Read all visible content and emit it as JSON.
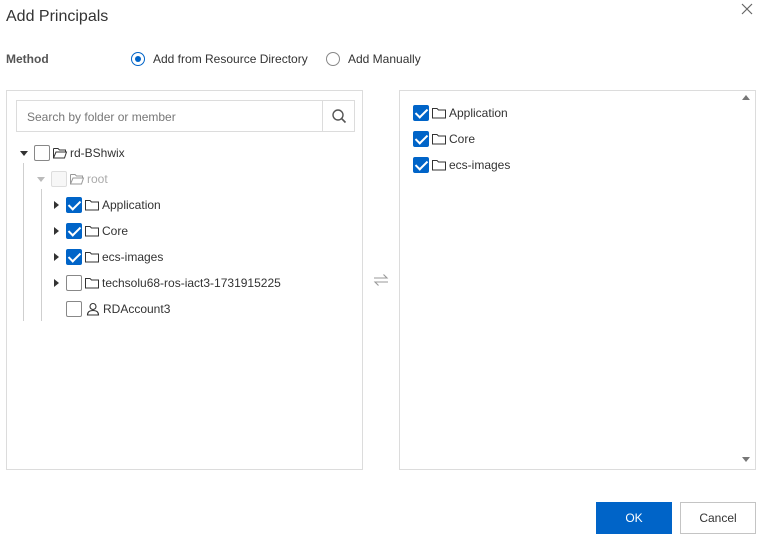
{
  "dialog": {
    "title": "Add Principals",
    "close_icon": "close-icon"
  },
  "method": {
    "label": "Method",
    "options": [
      {
        "label": "Add from Resource Directory",
        "selected": true
      },
      {
        "label": "Add Manually",
        "selected": false
      }
    ]
  },
  "left": {
    "search_placeholder": "Search by folder or member",
    "tree": {
      "root_dir": {
        "label": "rd-BShwix",
        "checked": false,
        "expanded": true
      },
      "root": {
        "label": "root",
        "checked": false,
        "disabled": true,
        "expanded": true
      },
      "children": [
        {
          "label": "Application",
          "checked": true,
          "type": "folder"
        },
        {
          "label": "Core",
          "checked": true,
          "type": "folder"
        },
        {
          "label": "ecs-images",
          "checked": true,
          "type": "folder"
        },
        {
          "label": "techsolu68-ros-iact3-1731915225",
          "checked": false,
          "type": "folder"
        },
        {
          "label": "RDAccount3",
          "checked": false,
          "type": "account"
        }
      ]
    }
  },
  "right": {
    "selected": [
      {
        "label": "Application",
        "checked": true
      },
      {
        "label": "Core",
        "checked": true
      },
      {
        "label": "ecs-images",
        "checked": true
      }
    ]
  },
  "footer": {
    "ok_label": "OK",
    "cancel_label": "Cancel"
  },
  "colors": {
    "accent": "#0064c8",
    "border": "#dcdcdc"
  }
}
